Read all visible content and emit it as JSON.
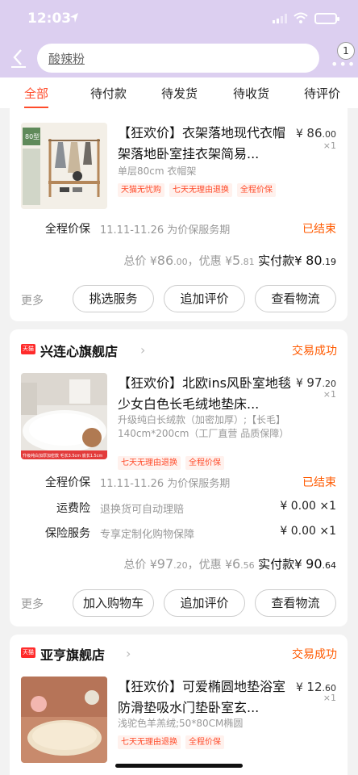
{
  "status_bar": {
    "time": "12:03"
  },
  "search": {
    "query": "酸辣粉",
    "more_badge": "1"
  },
  "tabs": [
    {
      "label": "全部"
    },
    {
      "label": "待付款"
    },
    {
      "label": "待发货"
    },
    {
      "label": "待收货"
    },
    {
      "label": "待评价"
    }
  ],
  "orders": [
    {
      "product": {
        "title": "【狂欢价】衣架落地现代衣帽架落地卧室挂衣架简易...",
        "sku": "单层80cm 衣帽架",
        "tags": [
          "天猫无忧购",
          "七天无理由退换",
          "全程价保"
        ],
        "price_symbol": "¥",
        "price_int": "86",
        "price_dec": ".00",
        "qty": "×1",
        "image_badge": "80型"
      },
      "services": [
        {
          "label": "全程价保",
          "desc": "11.11-11.26 为价保服务期",
          "right": "已结束"
        }
      ],
      "total": {
        "prefix": "总价 ¥",
        "total_int": "86",
        "total_dec": ".00",
        "discount_prefix": "，优惠 ¥",
        "discount_int": "5",
        "discount_dec": ".81",
        "paid_label": "实付款",
        "paid_symbol": "¥",
        "paid_int": "80",
        "paid_dec": ".19"
      },
      "more_label": "更多",
      "buttons": [
        "挑选服务",
        "追加评价",
        "查看物流"
      ]
    },
    {
      "shop": {
        "name": "兴连心旗舰店",
        "status": "交易成功",
        "badge": "天猫"
      },
      "product": {
        "title": "【狂欢价】北欧ins风卧室地毯少女白色长毛绒地垫床...",
        "sku": "升级纯白长绒款（加密加厚）;【长毛】140cm*200cm（工厂直营 品质保障）",
        "tags": [
          "七天无理由退换",
          "全程价保"
        ],
        "price_symbol": "¥",
        "price_int": "97",
        "price_dec": ".20",
        "qty": "×1",
        "image_caption": "升级纯白加厚加密款 毛长3.5cm 底长1.5cm"
      },
      "services": [
        {
          "label": "全程价保",
          "desc": "11.11-11.26 为价保服务期",
          "right": "已结束"
        },
        {
          "label": "运费险",
          "desc": "退换货可自动理赔",
          "right": "¥ 0.00 ×1"
        },
        {
          "label": "保险服务",
          "desc": "专享定制化购物保障",
          "right": "¥ 0.00 ×1"
        }
      ],
      "total": {
        "prefix": "总价 ¥",
        "total_int": "97",
        "total_dec": ".20",
        "discount_prefix": "，优惠 ¥",
        "discount_int": "6",
        "discount_dec": ".56",
        "paid_label": "实付款",
        "paid_symbol": "¥",
        "paid_int": "90",
        "paid_dec": ".64"
      },
      "more_label": "更多",
      "buttons": [
        "加入购物车",
        "追加评价",
        "查看物流"
      ]
    },
    {
      "shop": {
        "name": "亚亨旗舰店",
        "status": "交易成功",
        "badge": "天猫"
      },
      "product": {
        "title": "【狂欢价】可爱椭圆地垫浴室防滑垫吸水门垫卧室玄...",
        "sku": "浅驼色羊羔绒;50*80CM椭圆",
        "tags": [
          "七天无理由退换",
          "全程价保"
        ],
        "price_symbol": "¥",
        "price_int": "12",
        "price_dec": ".60",
        "qty": "×1"
      }
    }
  ],
  "colors": {
    "accent": "#ff4c2b",
    "status_orange": "#ff5a00",
    "header_bg": "#dccff0",
    "page_bg": "#f2f2f2"
  }
}
